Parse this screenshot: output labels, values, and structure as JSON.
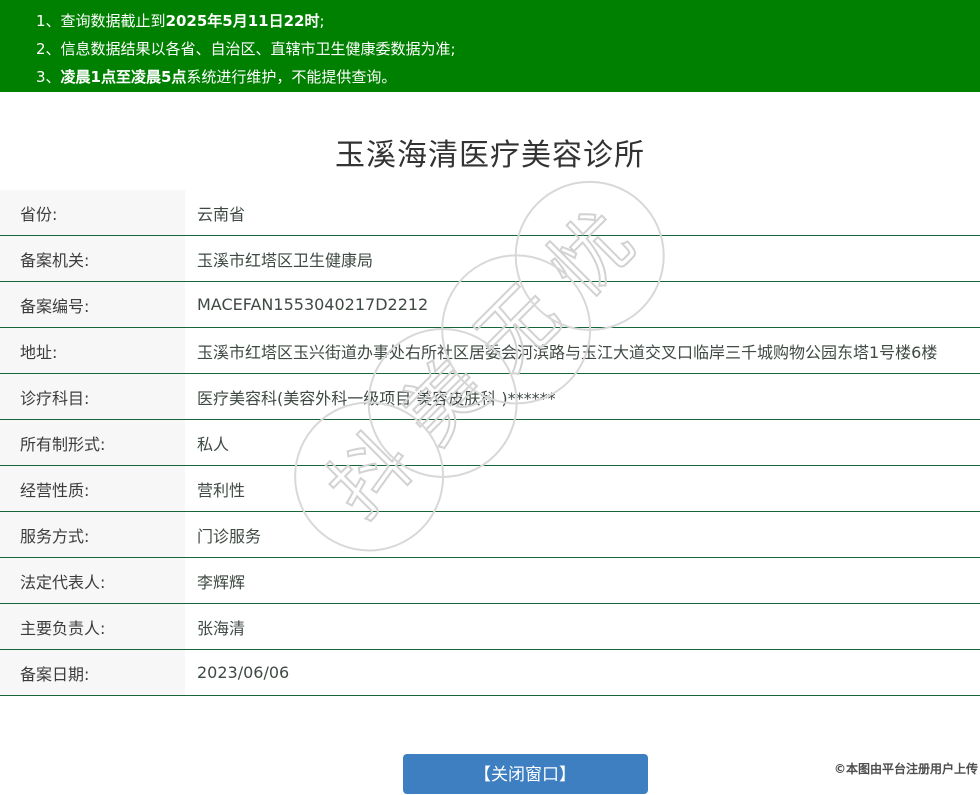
{
  "header": {
    "notices": [
      {
        "num": "1、",
        "pre": "查询数据截止到",
        "bold": "2025年5月11日22时",
        "post": ";"
      },
      {
        "num": "2、",
        "pre": "信息数据结果以各省、自治区、直辖市卫生健康委数据为准;",
        "bold": "",
        "post": ""
      },
      {
        "num": "3、",
        "pre": "",
        "bold": "凌晨1点至凌晨5点",
        "post": "系统进行维护，不能提供查询。"
      }
    ]
  },
  "page": {
    "title": "玉溪海清医疗美容诊所"
  },
  "record": {
    "rows": [
      {
        "label": "省份:",
        "value": "云南省"
      },
      {
        "label": "备案机关:",
        "value": "玉溪市红塔区卫生健康局"
      },
      {
        "label": "备案编号:",
        "value": "MACEFAN1553040217D2212"
      },
      {
        "label": "地址:",
        "value": "玉溪市红塔区玉兴街道办事处右所社区居委会河滨路与玉江大道交叉口临岸三千城购物公园东塔1号楼6楼"
      },
      {
        "label": "诊疗科目:",
        "value": "医疗美容科(美容外科一级项目 美容皮肤科 )******"
      },
      {
        "label": "所有制形式:",
        "value": "私人"
      },
      {
        "label": "经营性质:",
        "value": "营利性"
      },
      {
        "label": "服务方式:",
        "value": "门诊服务"
      },
      {
        "label": "法定代表人:",
        "value": "李辉辉"
      },
      {
        "label": "主要负责人:",
        "value": "张海清"
      },
      {
        "label": "备案日期:",
        "value": "2023/06/06"
      }
    ]
  },
  "watermark": {
    "text": "抖美无忧"
  },
  "footer": {
    "close_button_label": "【关闭窗口】",
    "copyright": "©本图由平台注册用户上传"
  },
  "colors": {
    "header_bg": "#008000",
    "row_border": "#15673a",
    "label_bg": "#f7f7f7",
    "button_bg": "#3d7fc1",
    "watermark": "#d2d2d2"
  }
}
